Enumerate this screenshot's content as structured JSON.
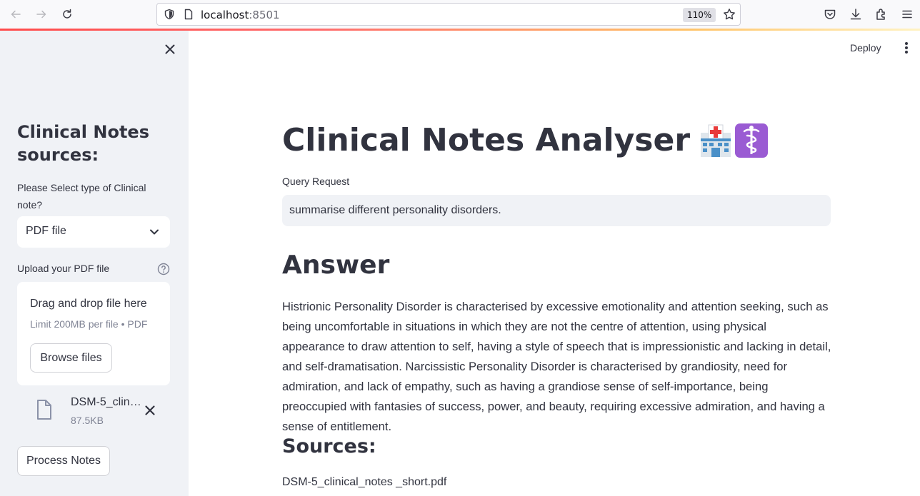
{
  "browser": {
    "url_host": "localhost",
    "url_port": ":8501",
    "zoom": "110%"
  },
  "sidebar": {
    "title": "Clinical Notes sources:",
    "select_label": "Please Select type of Clinical note?",
    "select_value": "PDF file",
    "upload_label": "Upload your PDF file",
    "dropzone_title": "Drag and drop file here",
    "dropzone_limit": "Limit 200MB per file • PDF",
    "browse_button": "Browse files",
    "uploaded_file": {
      "name": "DSM-5_clinical_notes _short.pdf",
      "size": "87.5KB"
    },
    "process_button": "Process Notes"
  },
  "header": {
    "deploy_label": "Deploy"
  },
  "main": {
    "title": "Clinical Notes Analyser",
    "title_emoji": [
      "hospital-icon",
      "medical-symbol-icon"
    ],
    "query_label": "Query Request",
    "query_value": "summarise different personality disorders.",
    "answer_heading": "Answer",
    "answer_text": "Histrionic Personality Disorder is characterised by excessive emotionality and attention seeking, such as being uncomfortable in situations in which they are not the centre of attention, using physical appearance to draw attention to self, having a style of speech that is impressionistic and lacking in detail, and self-dramatisation. Narcissistic Personality Disorder is characterised by grandiosity, need for admiration, and lack of empathy, such as having a grandiose sense of self-importance, being preoccupied with fantasies of success, power, and beauty, requiring excessive admiration, and having a sense of entitlement.",
    "sources_heading": "Sources:",
    "sources": [
      "DSM-5_clinical_notes _short.pdf"
    ]
  },
  "colors": {
    "sidebar_bg": "#f0f2f6",
    "text": "#31333f",
    "accent": "#ff4b4b",
    "muted": "#808495",
    "emoji_purple": "#9a5bd3"
  }
}
